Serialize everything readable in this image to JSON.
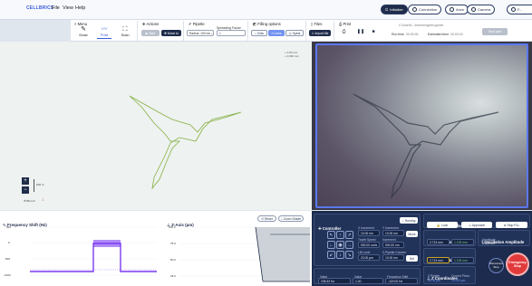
{
  "app": {
    "brand": "CELLBRICS"
  },
  "menu": [
    "File",
    "View",
    "Help"
  ],
  "status": {
    "initialize": "Initialize",
    "connection": "Connection",
    "axes": "Axes",
    "camera": "Camera",
    "more": "F..."
  },
  "ribbon": {
    "menu": {
      "title": "Menu",
      "items": [
        "Draw",
        "Print",
        "Scan"
      ]
    },
    "actions": {
      "title": "Actions",
      "start": "Start",
      "move_to": "Move to"
    },
    "pipette": {
      "title": "Pipette",
      "value": "Radius: 100 nm",
      "spreading_label": "Spreading Factor",
      "spreading_value": "1"
    },
    "filling": {
      "title": "Filling options",
      "options": [
        "Dots",
        "Lines",
        "Spiral"
      ]
    },
    "files": {
      "title": "Files",
      "import": "Import file"
    },
    "print": {
      "title": "Print",
      "path": "C:\\Users\\...\\hummingbird.gcode",
      "controls": [
        "Printer",
        "Pause",
        "Stop"
      ],
      "time_label": "Run time",
      "time_value": "00:00:00",
      "est_label": "Estimated time",
      "est_value": "00:03:15",
      "right_btn": "Start print"
    }
  },
  "view_left": {
    "info_line1": "+ 0.00 mm",
    "info_line2": "+ 0.000 mm",
    "scale_text": "100 m",
    "zoom_label": "80 nm²"
  },
  "panels": {
    "freq_shift": {
      "title": "Frequency Shift (Hz)",
      "y_ticks": [
        "500",
        "0",
        "-500",
        "-1000"
      ]
    },
    "z_axis": {
      "title": "Z-Axis (µm)",
      "btn1": "Reset",
      "btn2": "Zoom Shade",
      "y_ticks": [
        "100.0",
        "75.0",
        "50.0",
        "25.0"
      ]
    }
  },
  "controller": {
    "title": "Controller",
    "homing": "Homing",
    "xy_inc_label": "X Increment",
    "xy_inc_value": "10.00 nm",
    "y_inc_label": "Y Increment",
    "y_inc_value": "10.00 nm",
    "travel_label": "Travel Speed",
    "travel_value": "500.00 um/s",
    "z_inc_label": "Increment",
    "z_inc_value": "500.00 nm",
    "lift_label": "Lift Level",
    "lift_value": "20.00 µm",
    "pip_label": "Z-Pipette Counter",
    "pip_value": "10.00 nm",
    "move_btn": "Move",
    "set_btn": "Set"
  },
  "phase": {
    "title": "Phase locked loop",
    "lock": "Lock",
    "approach": "Approach",
    "stop": "Stop PLL"
  },
  "current": {
    "title": "Current Coordinates",
    "x": "2.713 mm",
    "y": "1.193 mm"
  },
  "target": {
    "title": "Target Coordinates",
    "x": "2.713 mm",
    "y": "1.193 mm"
  },
  "oscill": {
    "title": "Oscillation Amplitude",
    "label": "Amplitude",
    "value": "0.013 mV"
  },
  "z_coord": {
    "title": "Z Coordinates",
    "z_label": "Z Pipette",
    "z_value": "20.00 µm",
    "t_label": "Current Piezo",
    "t_value": "11.003 µm"
  },
  "frequency": {
    "title": "Frequency",
    "value_label": "Value",
    "value": "238.33 Hz",
    "v2_label": "Value",
    "v2": "1.00",
    "fs_label": "Frequency Shift",
    "fs": "-120.00 Hz"
  },
  "emergency": {
    "disconnect": "Disconnect Stop",
    "stop": "Emergency Stop"
  }
}
